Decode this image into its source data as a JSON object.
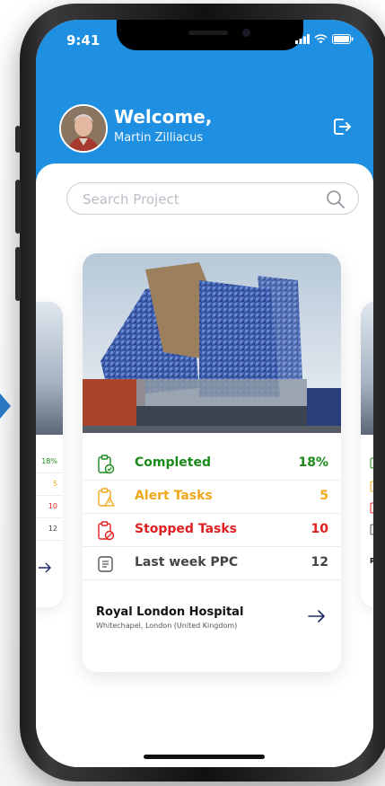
{
  "status": {
    "time": "9:41"
  },
  "header": {
    "welcome": "Welcome,",
    "username": "Martin Zilliacus"
  },
  "search": {
    "placeholder": "Search Project"
  },
  "card": {
    "stats": [
      {
        "label": "Completed",
        "value": "18%",
        "color": "#1a8a1a",
        "icon": "clipboard-check-icon"
      },
      {
        "label": "Alert Tasks",
        "value": "5",
        "color": "#f0a81c",
        "icon": "clipboard-alert-icon"
      },
      {
        "label": "Stopped Tasks",
        "value": "10",
        "color": "#e02020",
        "icon": "clipboard-stop-icon"
      },
      {
        "label": "Last week PPC",
        "value": "12",
        "color": "#444444",
        "icon": "list-doc-icon"
      }
    ],
    "project_name": "Royal London Hospital",
    "project_location": "Whitechapel, London (United Kingdom)"
  },
  "side_left": {
    "values": [
      "18%",
      "5",
      "10",
      "12"
    ]
  },
  "side_right": {
    "name_fragment": "Ro"
  },
  "colors": {
    "header": "#1e8fe1",
    "accent_arrow": "#1f2a6b"
  }
}
